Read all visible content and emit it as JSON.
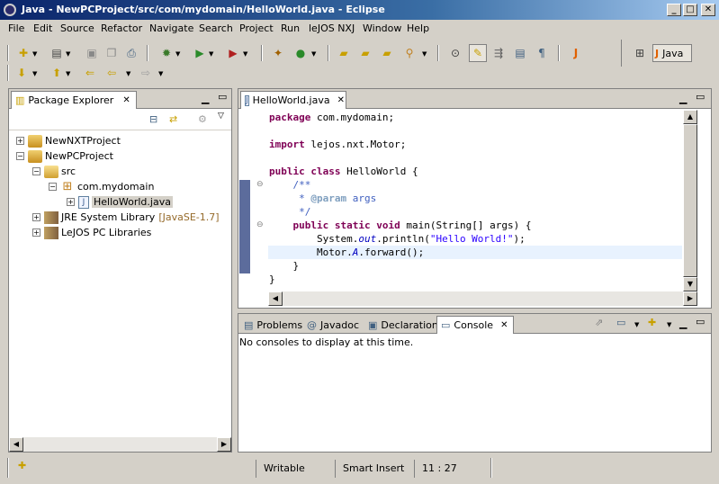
{
  "window": {
    "title": "Java - NewPCProject/src/com/mydomain/HelloWorld.java - Eclipse"
  },
  "menu": [
    "File",
    "Edit",
    "Source",
    "Refactor",
    "Navigate",
    "Search",
    "Project",
    "Run",
    "leJOS NXJ",
    "Window",
    "Help"
  ],
  "perspective": {
    "label": "Java"
  },
  "package_explorer": {
    "title": "Package Explorer",
    "items": [
      {
        "label": "NewNXTProject"
      },
      {
        "label": "NewPCProject"
      },
      {
        "label": "src"
      },
      {
        "label": "com.mydomain"
      },
      {
        "label": "HelloWorld.java"
      },
      {
        "label": "JRE System Library",
        "suffix": "[JavaSE-1.7]"
      },
      {
        "label": "LeJOS PC Libraries"
      }
    ]
  },
  "editor": {
    "tab": "HelloWorld.java",
    "lines": [
      {
        "parts": [
          {
            "t": "package",
            "c": "kw"
          },
          {
            "t": " com.mydomain;"
          }
        ]
      },
      {
        "parts": []
      },
      {
        "parts": [
          {
            "t": "import",
            "c": "kw"
          },
          {
            "t": " lejos.nxt.Motor;"
          }
        ]
      },
      {
        "parts": []
      },
      {
        "parts": [
          {
            "t": "public",
            "c": "kw"
          },
          {
            "t": " "
          },
          {
            "t": "class",
            "c": "kw"
          },
          {
            "t": " HelloWorld {"
          }
        ]
      },
      {
        "parts": [
          {
            "t": "    /**",
            "c": "cm"
          }
        ]
      },
      {
        "parts": [
          {
            "t": "     * ",
            "c": "cm"
          },
          {
            "t": "@param",
            "c": "tag"
          },
          {
            "t": " args",
            "c": "cm"
          }
        ]
      },
      {
        "parts": [
          {
            "t": "     */",
            "c": "cm"
          }
        ]
      },
      {
        "parts": [
          {
            "t": "    "
          },
          {
            "t": "public",
            "c": "kw"
          },
          {
            "t": " "
          },
          {
            "t": "static",
            "c": "kw"
          },
          {
            "t": " "
          },
          {
            "t": "void",
            "c": "kw"
          },
          {
            "t": " main(String[] args) {"
          }
        ]
      },
      {
        "parts": [
          {
            "t": "        System."
          },
          {
            "t": "out",
            "c": "fld"
          },
          {
            "t": ".println("
          },
          {
            "t": "\"Hello World!\"",
            "c": "str"
          },
          {
            "t": ");"
          }
        ]
      },
      {
        "parts": [
          {
            "t": "        Motor."
          },
          {
            "t": "A",
            "c": "fld"
          },
          {
            "t": ".forward();"
          }
        ]
      },
      {
        "parts": [
          {
            "t": "    }"
          }
        ]
      },
      {
        "parts": [
          {
            "t": "}"
          }
        ]
      }
    ]
  },
  "bottom_tabs": [
    "Problems",
    "Javadoc",
    "Declaration",
    "Console"
  ],
  "console": {
    "message": "No consoles to display at this time."
  },
  "status": {
    "mode": "Writable",
    "insert": "Smart Insert",
    "position": "11 : 27"
  },
  "colors": {
    "title_start": "#0a246a",
    "title_end": "#a6caf0",
    "current_line": "#e8f2fe",
    "keyword": "#7f0055",
    "string": "#2a00ff"
  }
}
